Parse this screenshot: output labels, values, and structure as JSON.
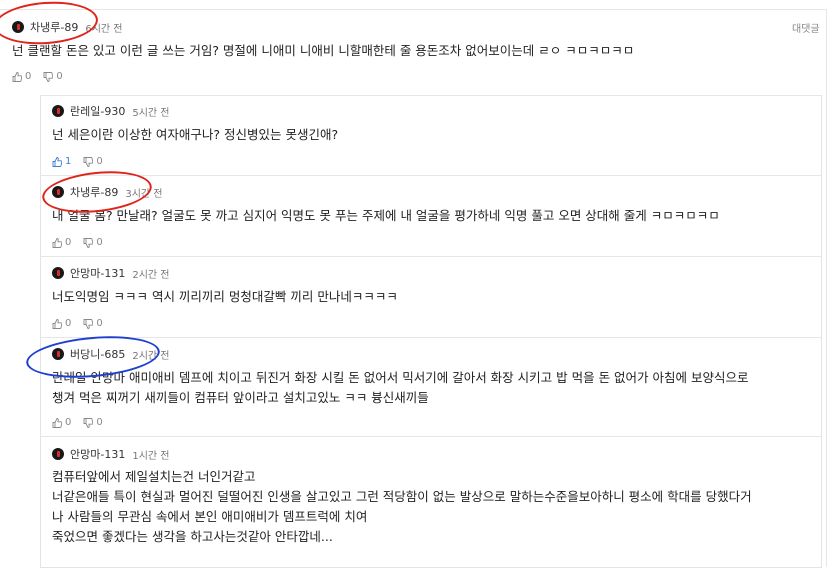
{
  "reply_label": "대댓글",
  "comments": [
    {
      "nick": "차냉루-89",
      "time": "6시간 전",
      "lines": [
        "넌 클랜할 돈은 있고 이런 글 쓰는 거임? 명절에 니애미 니애비 니할매한테 줄 용돈조차 없어보이는데 ㄹㅇ ㅋㅁㅋㅁㅋㅁ"
      ],
      "likes": "0",
      "dislikes": "0"
    }
  ],
  "replies": [
    {
      "nick": "란레일-930",
      "time": "5시간 전",
      "lines": [
        "넌 세은이란 이상한 여자애구나? 정신병있는 못생긴애?"
      ],
      "likes": "1",
      "dislikes": "0"
    },
    {
      "nick": "차냉루-89",
      "time": "3시간 전",
      "lines": [
        "내 얼굴 봄? 만날래? 얼굴도 못 까고 심지어 익명도 못 푸는 주제에 내 얼굴을 평가하네 익명 풀고 오면 상대해 줄게 ㅋㅁㅋㅁㅋㅁ"
      ],
      "likes": "0",
      "dislikes": "0"
    },
    {
      "nick": "안망마-131",
      "time": "2시간 전",
      "lines": [
        "너도익명임 ㅋㅋㅋ 역시 끼리끼리 멍청대갈빡 끼리 만나네ㅋㅋㅋㅋ"
      ],
      "likes": "0",
      "dislikes": "0"
    },
    {
      "nick": "버당니-685",
      "time": "2시간 전",
      "lines": [
        "란레일 안망마 애미애비 뎀프에 치이고 뒤진거 화장 시킬 돈 없어서 믹서기에 갈아서 화장 시키고 밥 먹을 돈 없어가 아침에 보양식으로",
        "챙겨 먹은 찌꺼기 새끼들이 컴퓨터 앞이라고 설치고있노 ㅋㅋ 븅신새끼들"
      ],
      "likes": "0",
      "dislikes": "0"
    },
    {
      "nick": "안망마-131",
      "time": "1시간 전",
      "lines": [
        "컴퓨터앞에서 제일설치는건 너인거같고",
        "너같은애들 특이 현실과 멀어진 덜떨어진 인생을 살고있고 그런 적당함이 없는 발상으로 말하는수준을보아하니 평소에 학대를 당했다거",
        "나 사람들의 무관심 속에서 본인 애미애비가 뎀프트럭에 치여",
        "죽었으면 좋겠다는 생각을 하고사는것같아 안타깝네..."
      ],
      "likes": "",
      "dislikes": ""
    }
  ],
  "colors": {
    "accent": "#3a7bd5",
    "red_mark": "#e0241b",
    "blue_mark": "#1f3fd1"
  }
}
